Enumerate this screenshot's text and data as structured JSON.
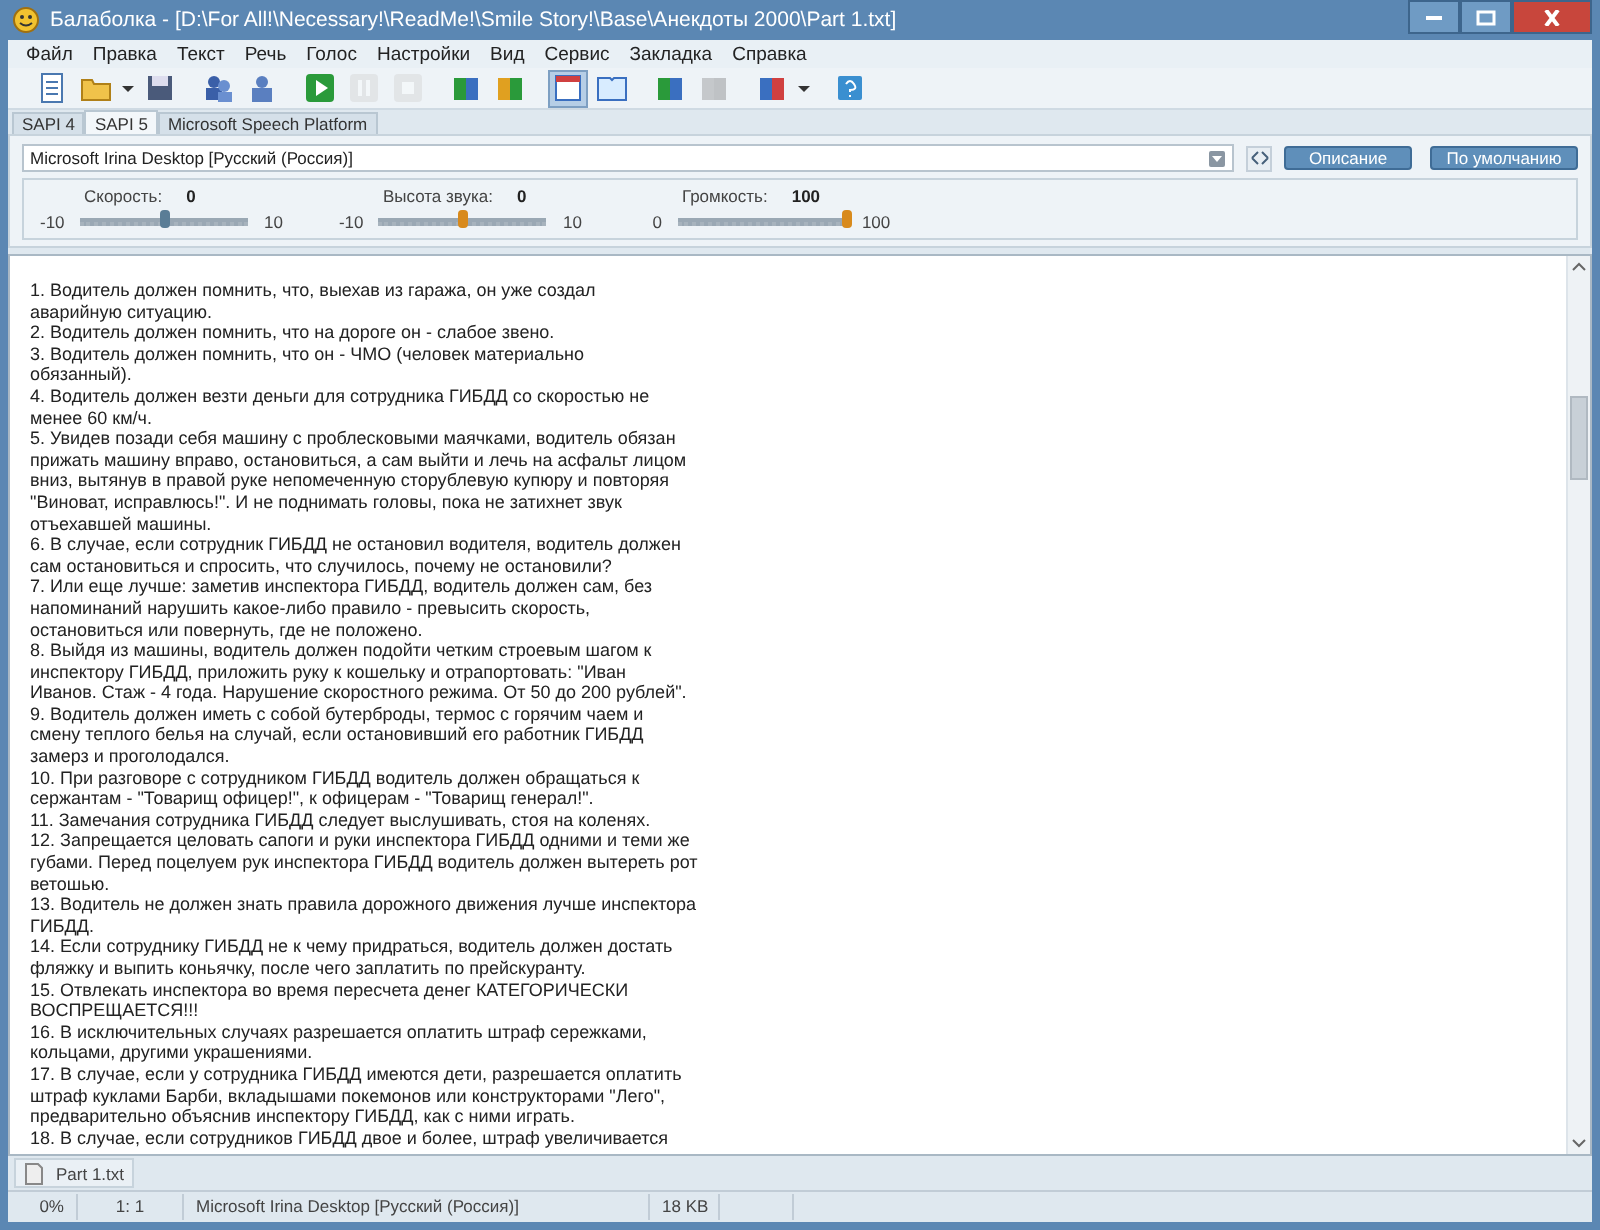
{
  "window": {
    "title": "Балаболка - [D:\\For All!\\Necessary!\\ReadMe!\\Smile Story!\\Base\\Анекдоты 2000\\Part 1.txt]"
  },
  "menu": [
    "Файл",
    "Правка",
    "Текст",
    "Речь",
    "Голос",
    "Настройки",
    "Вид",
    "Сервис",
    "Закладка",
    "Справка"
  ],
  "toolbar": [
    [
      {
        "kind": "new",
        "disabled": false,
        "selected": false
      },
      {
        "kind": "open",
        "disabled": false,
        "selected": false
      },
      {
        "kind": "caret",
        "disabled": false,
        "selected": false
      },
      {
        "kind": "save",
        "disabled": false,
        "selected": false
      }
    ],
    [
      {
        "kind": "people",
        "disabled": false,
        "selected": false
      },
      {
        "kind": "people2",
        "disabled": false,
        "selected": false
      }
    ],
    [
      {
        "kind": "play",
        "disabled": false,
        "selected": false
      },
      {
        "kind": "pause",
        "disabled": true,
        "selected": false
      },
      {
        "kind": "stop",
        "disabled": true,
        "selected": false
      }
    ],
    [
      {
        "kind": "books",
        "disabled": false,
        "selected": false
      },
      {
        "kind": "books2",
        "disabled": false,
        "selected": false
      }
    ],
    [
      {
        "kind": "window",
        "disabled": false,
        "selected": true
      },
      {
        "kind": "book",
        "disabled": false,
        "selected": false
      }
    ],
    [
      {
        "kind": "books",
        "disabled": false,
        "selected": false
      },
      {
        "kind": "books",
        "disabled": true,
        "selected": false
      }
    ],
    [
      {
        "kind": "bookred",
        "disabled": false,
        "selected": false
      },
      {
        "kind": "caret",
        "disabled": false,
        "selected": false
      }
    ],
    [
      {
        "kind": "help",
        "disabled": false,
        "selected": false
      }
    ]
  ],
  "tabs": [
    {
      "label": "SAPI 4",
      "selected": false
    },
    {
      "label": "SAPI 5",
      "selected": true
    },
    {
      "label": "Microsoft Speech Platform",
      "selected": false
    }
  ],
  "voice": {
    "value": "Microsoft Irina Desktop [Русский (Россия)]",
    "buttons": [
      "Описание",
      "По умолчанию"
    ]
  },
  "sliders": [
    {
      "label": "Скорость:",
      "value": "0",
      "min": "-10",
      "max": "10",
      "level": 0.5,
      "color": "#5a7d96"
    },
    {
      "label": "Высота звука:",
      "value": "0",
      "min": "-10",
      "max": "10",
      "level": 0.5,
      "color": "#d88a1c"
    },
    {
      "label": "Громкость:",
      "value": "100",
      "min": "0",
      "max": "100",
      "level": 1,
      "color": "#d88a1c"
    }
  ],
  "editor": {
    "lines": [
      "1. Водитель должен помнить, что, выехав из гаража, он уже создал",
      "аварийную ситуацию.",
      "2. Водитель должен помнить, что на дороге он - слабое звено.",
      "3. Водитель должен помнить, что он - ЧМО (человек материально",
      "обязанный).",
      "4. Водитель должен везти деньги для сотрудника ГИБДД со скоростью не",
      "менее 60 км/ч.",
      "5. Увидев позади себя машину с проблесковыми маячками, водитель обязан",
      "прижать машину вправо, остановиться, а сам выйти и лечь на асфальт лицом",
      "вниз, вытянув в правой руке непомеченную сторублевую купюру и повторяя",
      "\"Виноват, исправлюсь!\". И не поднимать головы, пока не затихнет звук",
      "отъехавшей машины.",
      "6. В случае, если сотрудник ГИБДД не остановил водителя, водитель должен",
      "сам остановиться и спросить, что случилось, почему не остановили?",
      "7. Или еще лучше: заметив инспектора ГИБДД, водитель должен сам, без",
      "напоминаний нарушить какое-либо правило - превысить скорость,",
      "остановиться или повернуть, где не положено.",
      "8. Выйдя из машины, водитель должен подойти четким строевым шагом к",
      "инспектору ГИБДД, приложить руку к кошельку и отрапортовать: \"Иван",
      "Иванов. Стаж - 4 года. Нарушение скоростного режима. От 50 до 200 рублей\".",
      "9. Водитель должен иметь с собой бутерброды, термос с горячим чаем и",
      "смену теплого белья на случай, если остановивший его работник ГИБДД",
      "замерз и проголодался.",
      "10. При разговоре с сотрудником ГИБДД водитель должен обращаться к",
      "сержантам - \"Товарищ офицер!\", к офицерам - \"Товарищ генерал!\".",
      "11. Замечания сотрудника ГИБДД следует выслушивать, стоя на коленях.",
      "12. Запрещается целовать сапоги и руки инспектора ГИБДД одними и теми же",
      "губами. Перед поцелуем рук инспектора ГИБДД водитель должен вытереть рот",
      "ветошью.",
      "13. Водитель не должен знать правила дорожного движения лучше инспектора",
      "ГИБДД.",
      "14. Если сотруднику ГИБДД не к чему придраться, водитель должен достать",
      "фляжку и выпить коньячку, после чего заплатить по прейскуранту.",
      "15. Отвлекать инспектора во время пересчета денег КАТЕГОРИЧЕСКИ",
      "ВОСПРЕЩАЕТСЯ!!!",
      "16. В исключительных случаях разрешается оплатить штраф сережками,",
      "кольцами, другими украшениями.",
      "17. В случае, если у сотрудника ГИБДД имеются дети, разрешается оплатить",
      "штраф куклами Барби, вкладышами покемонов или конструкторами \"Лего\",",
      "предварительно объяснив инспектору ГИБДД, как с ними играть.",
      "18. В случае, если сотрудников ГИБДД двое и более, штраф увеличивается"
    ]
  },
  "documents": [
    {
      "label": "Part 1.txt",
      "selected": true
    }
  ],
  "status_bar": [
    "0%",
    "1:   1",
    "Microsoft Irina Desktop [Русский (Россия)]",
    "18 KB"
  ]
}
